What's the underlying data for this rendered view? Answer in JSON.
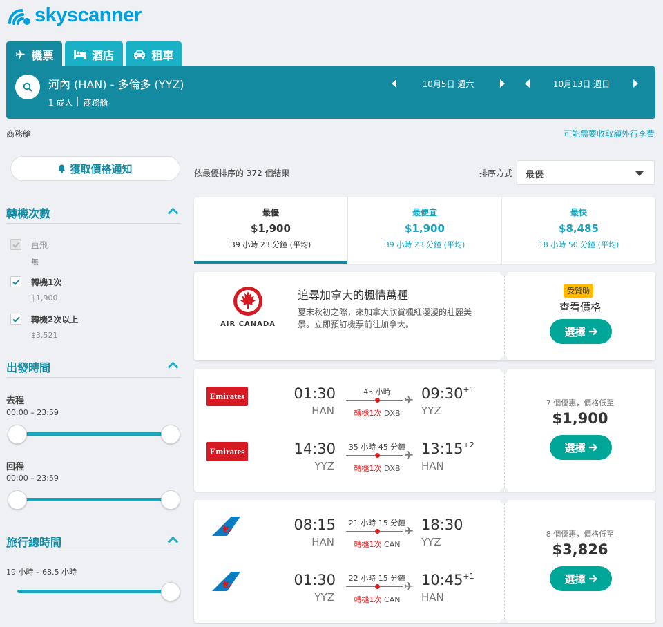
{
  "brand": {
    "name": "skyscanner"
  },
  "tabs": [
    {
      "label": "機票",
      "icon": "plane-icon",
      "active": true
    },
    {
      "label": "酒店",
      "icon": "bed-icon",
      "active": false
    },
    {
      "label": "租車",
      "icon": "car-icon",
      "active": false
    }
  ],
  "search": {
    "route": "河內 (HAN) - 多倫多 (YYZ)",
    "passengers": "1 成人",
    "cabin": "商務艙",
    "depart_date": "10月5日 週六",
    "return_date": "10月13日 週日"
  },
  "subheader": {
    "cabin": "商務艙",
    "baggage_link": "可能需要收取額外行李費"
  },
  "sidebar": {
    "alert_button": "獲取價格通知",
    "stops": {
      "title": "轉機次數",
      "options": [
        {
          "label": "直飛",
          "sub": "無",
          "checked": true,
          "disabled": true
        },
        {
          "label": "轉機1次",
          "sub": "$1,900",
          "checked": true,
          "disabled": false
        },
        {
          "label": "轉機2次以上",
          "sub": "$3,521",
          "checked": true,
          "disabled": false
        }
      ]
    },
    "departure_times": {
      "title": "出發時間",
      "outbound_label": "去程",
      "outbound_range": "00:00 – 23:59",
      "return_label": "回程",
      "return_range": "00:00 – 23:59"
    },
    "journey_duration": {
      "title": "旅行總時間",
      "range": "19 小時 – 68.5 小時"
    }
  },
  "results": {
    "count_text": "依最優排序的 372 個結果",
    "sort_label": "排序方式",
    "sort_value": "最優"
  },
  "summary": [
    {
      "title": "最優",
      "price": "$1,900",
      "duration": "39 小時 23 分鐘 (平均)"
    },
    {
      "title": "最便宜",
      "price": "$1,900",
      "duration": "39 小時 23 分鐘 (平均)"
    },
    {
      "title": "最快",
      "price": "$8,485",
      "duration": "18 小時 50 分鐘 (平均)"
    }
  ],
  "ad": {
    "airline": "AIR CANADA",
    "title": "追尋加拿大的楓情萬種",
    "description": "夏末秋初之際，來加拿大欣賞楓紅漫漫的壯麗美景。立即預訂機票前往加拿大。",
    "badge": "受贊助",
    "cta_text": "查看價格",
    "button": "選擇"
  },
  "flights": [
    {
      "deals": "7 個優惠，價格低至",
      "price": "$1,900",
      "button": "選擇",
      "legs": [
        {
          "airline": "Emirates",
          "dep_time": "01:30",
          "dep_code": "HAN",
          "duration": "43 小時",
          "stops": "轉機1次",
          "hub": "DXB",
          "arr_time": "09:30",
          "arr_offset": "+1",
          "arr_code": "YYZ"
        },
        {
          "airline": "Emirates",
          "dep_time": "14:30",
          "dep_code": "YYZ",
          "duration": "35 小時 45 分鐘",
          "stops": "轉機1次",
          "hub": "DXB",
          "arr_time": "13:15",
          "arr_offset": "+2",
          "arr_code": "HAN"
        }
      ]
    },
    {
      "deals": "8 個優惠，價格低至",
      "price": "$3,826",
      "button": "選擇",
      "legs": [
        {
          "airline": "China Southern",
          "dep_time": "08:15",
          "dep_code": "HAN",
          "duration": "21 小時 15 分鐘",
          "stops": "轉機1次",
          "hub": "CAN",
          "arr_time": "18:30",
          "arr_offset": "",
          "arr_code": "YYZ"
        },
        {
          "airline": "China Southern",
          "dep_time": "01:30",
          "dep_code": "YYZ",
          "duration": "22 小時 15 分鐘",
          "stops": "轉機1次",
          "hub": "CAN",
          "arr_time": "10:45",
          "arr_offset": "+1",
          "arr_code": "HAN"
        }
      ]
    }
  ],
  "colors": {
    "brand": "#00a0dc",
    "header": "#138aa0",
    "tab": "#1ab0c5",
    "accent": "#1aa3bb",
    "select_button": "#00a698",
    "stop_red": "#e02020",
    "sponsored": "#ffbb00"
  }
}
